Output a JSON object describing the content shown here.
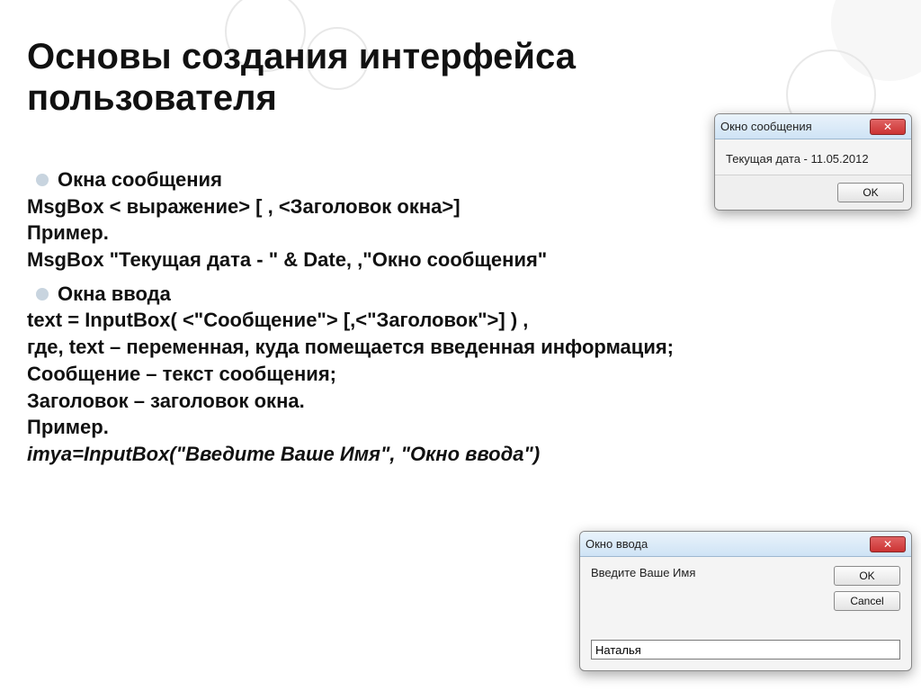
{
  "title": "Основы создания интерфейса пользователя",
  "section1": {
    "bullet": "Окна сообщения",
    "line1": "MsgBox < выражение> [ , <Заголовок окна>]",
    "line2": "Пример.",
    "line3": "MsgBox \"Текущая дата - \" & Date, ,\"Окно сообщения\""
  },
  "section2": {
    "bullet": "Окна ввода",
    "line1": "text = InputBox( <\"Сообщение\"> [,<\"Заголовок\">] ) ,",
    "line2": "где, text – переменная, куда помещается введенная информация;",
    "line3": "Сообщение – текст сообщения;",
    "line4": "Заголовок – заголовок окна.",
    "line5": "Пример.",
    "line6": "imya=InputBox(\"Введите Ваше Имя\", \"Окно ввода\")"
  },
  "dialog1": {
    "title": "Окно сообщения",
    "body": "Текущая дата - 11.05.2012",
    "ok": "OK"
  },
  "dialog2": {
    "title": "Окно ввода",
    "prompt": "Введите Ваше Имя",
    "ok": "OK",
    "cancel": "Cancel",
    "value": "Наталья"
  }
}
